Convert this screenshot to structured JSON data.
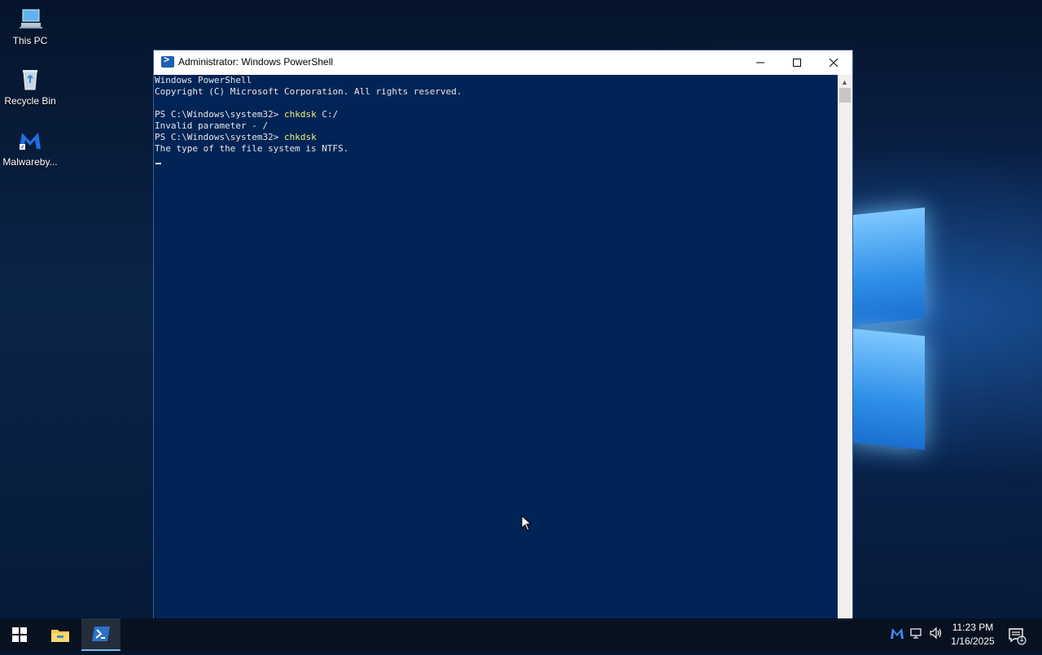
{
  "desktop": {
    "icons": [
      {
        "label": "This PC",
        "icon": "this-pc-icon"
      },
      {
        "label": "Recycle Bin",
        "icon": "recycle-bin-icon"
      },
      {
        "label": "Malwareby...",
        "icon": "malwarebytes-icon"
      }
    ]
  },
  "window": {
    "title": "Administrator: Windows PowerShell",
    "controls": {
      "minimize": "—",
      "maximize": "☐",
      "close": "✕"
    },
    "console": {
      "lines": [
        {
          "prompt": "Windows PowerShell",
          "cmd": ""
        },
        {
          "prompt": "Copyright (C) Microsoft Corporation. All rights reserved.",
          "cmd": ""
        },
        {
          "prompt": "",
          "cmd": ""
        },
        {
          "prompt": "PS C:\\Windows\\system32> ",
          "cmd": "chkdsk",
          "arg": " C:/"
        },
        {
          "prompt": "Invalid parameter - /",
          "cmd": ""
        },
        {
          "prompt": "PS C:\\Windows\\system32> ",
          "cmd": "chkdsk",
          "arg": ""
        },
        {
          "prompt": "The type of the file system is NTFS.",
          "cmd": ""
        }
      ]
    },
    "colors": {
      "console_bg": "#012456",
      "command_text": "#f1f17a"
    }
  },
  "taskbar": {
    "items": [
      {
        "icon": "windows-start-icon"
      },
      {
        "icon": "file-explorer-icon"
      },
      {
        "icon": "powershell-icon",
        "active": true
      }
    ],
    "tray": [
      "malwarebytes-tray-icon",
      "network-icon",
      "volume-icon"
    ],
    "clock": {
      "time": "11:23 PM",
      "date": "1/16/2025"
    },
    "notification_count": "1"
  }
}
